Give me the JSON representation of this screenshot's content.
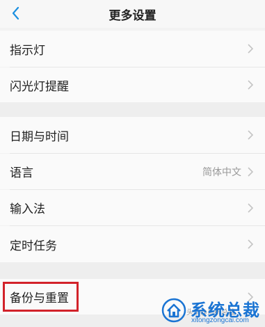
{
  "header": {
    "title": "更多设置"
  },
  "group1": [
    {
      "label": "指示灯"
    },
    {
      "label": "闪光灯提醒"
    }
  ],
  "group2": [
    {
      "label": "日期与时间"
    },
    {
      "label": "语言",
      "value": "简体中文"
    },
    {
      "label": "输入法"
    },
    {
      "label": "定时任务"
    }
  ],
  "group3": [
    {
      "label": "备份与重置"
    }
  ],
  "watermark": {
    "small": "头条@系统总裁",
    "brand": "系统总裁",
    "url": "xitongzongcai.com"
  },
  "colors": {
    "highlight": "#d2222a",
    "accent": "#1a74d3"
  }
}
